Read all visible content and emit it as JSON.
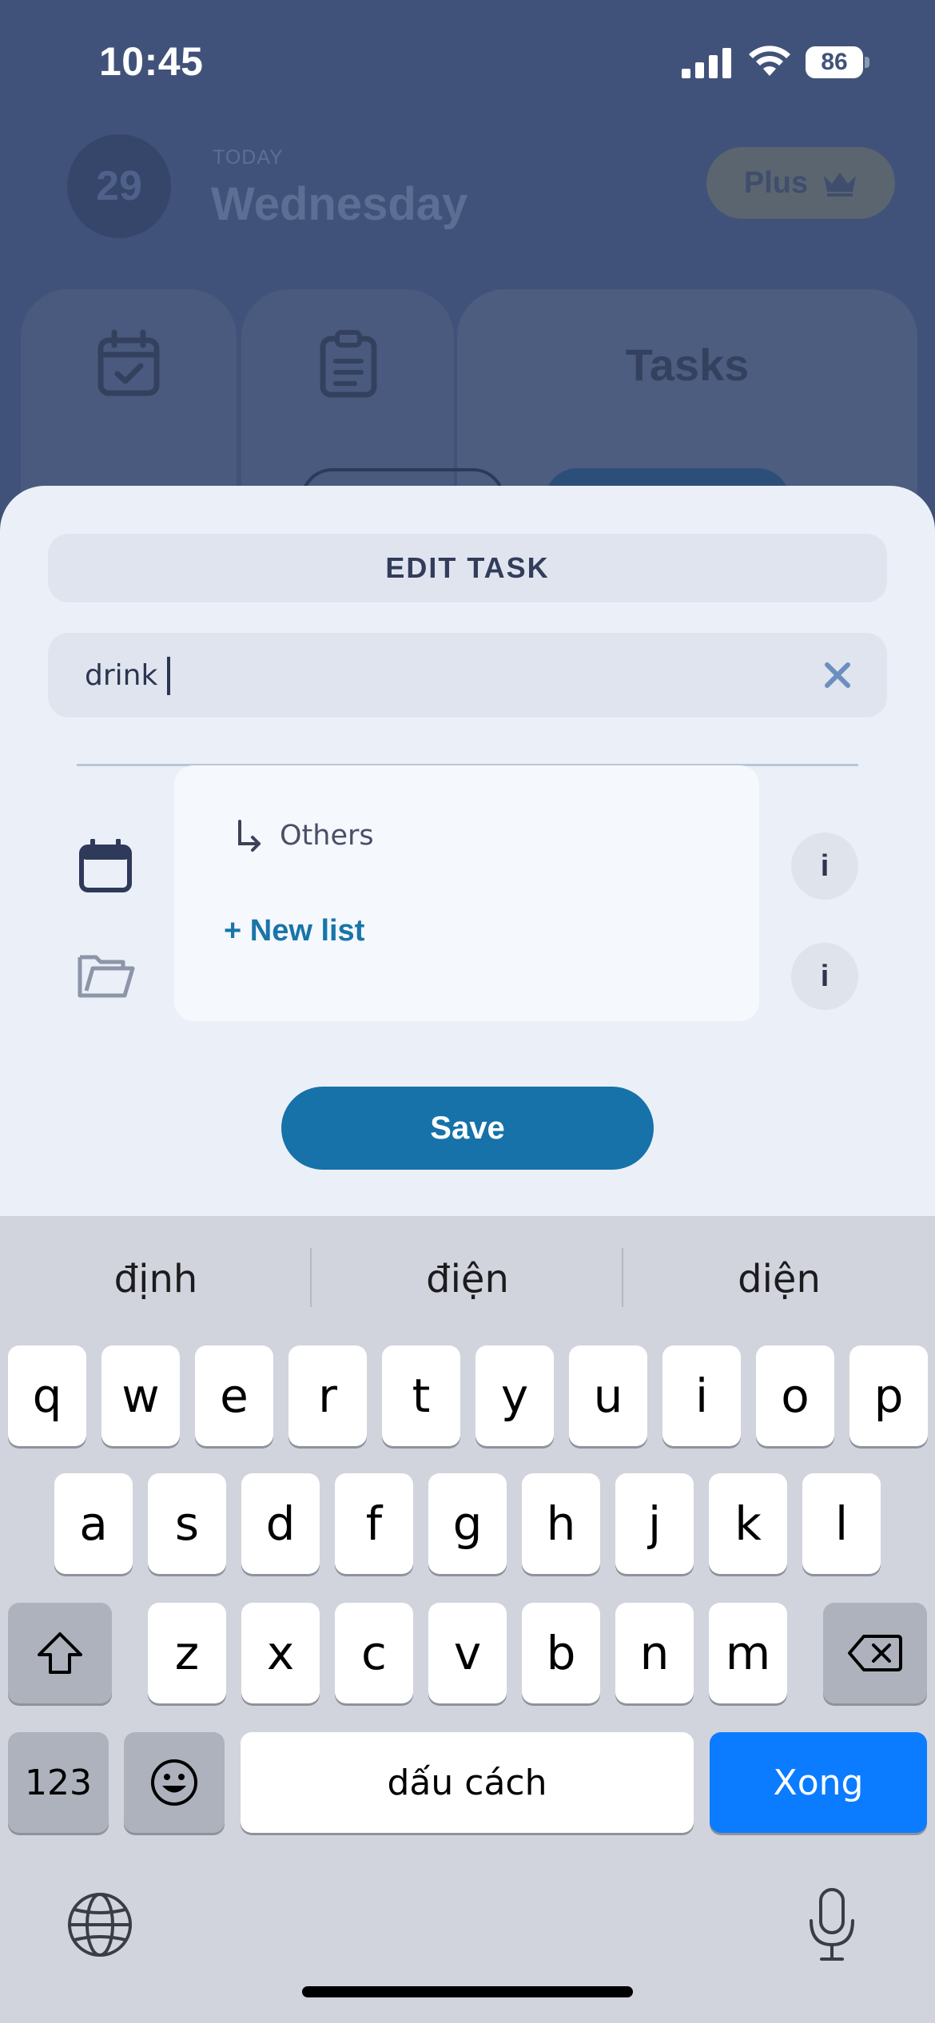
{
  "status_bar": {
    "time": "10:45",
    "battery": "86"
  },
  "background_app": {
    "day_number": "29",
    "today_label": "TODAY",
    "weekday": "Wednesday",
    "plus_label": "Plus",
    "tasks_tab_label": "Tasks",
    "icons": [
      "calendar-check-icon",
      "clipboard-list-icon",
      "crown-icon"
    ]
  },
  "edit_sheet": {
    "title": "EDIT TASK",
    "task_input": {
      "value": "drink",
      "placeholder": ""
    },
    "rows": [
      {
        "icon": "calendar-icon"
      },
      {
        "icon": "folder-icon"
      }
    ],
    "info_label": "i",
    "dropdown": {
      "items": [
        {
          "label": "Others",
          "icon": "subdirectory-arrow-icon"
        }
      ],
      "new_list_label": "+ New list"
    },
    "save_label": "Save",
    "accent_color": "#1672a8"
  },
  "keyboard": {
    "suggestions": [
      "định",
      "điện",
      "diện"
    ],
    "row1": [
      "q",
      "w",
      "e",
      "r",
      "t",
      "y",
      "u",
      "i",
      "o",
      "p"
    ],
    "row2": [
      "a",
      "s",
      "d",
      "f",
      "g",
      "h",
      "j",
      "k",
      "l"
    ],
    "row3": [
      "z",
      "x",
      "c",
      "v",
      "b",
      "n",
      "m"
    ],
    "numbers_label": "123",
    "space_label": "dấu cách",
    "return_label": "Xong",
    "return_color": "#0b7cff"
  }
}
